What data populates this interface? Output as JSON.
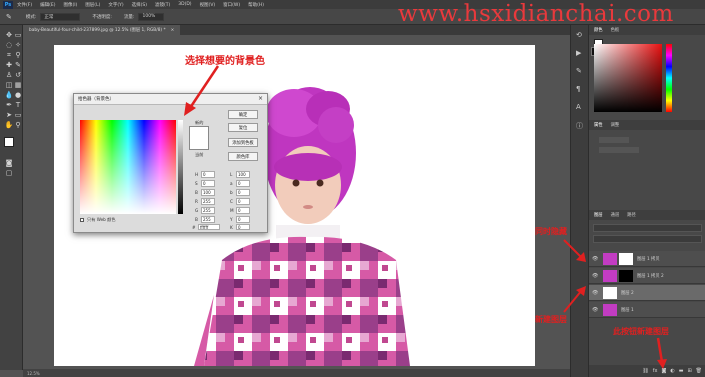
{
  "menubar": {
    "app_icon": "Ps",
    "items": [
      "文件(F)",
      "编辑(E)",
      "图像(I)",
      "图层(L)",
      "文字(Y)",
      "选择(S)",
      "滤镜(T)",
      "3D(D)",
      "视图(V)",
      "窗口(W)",
      "帮助(H)"
    ]
  },
  "options": {
    "mode_label": "模式:",
    "mode_value": "正常",
    "opacity_label": "不透明度:",
    "flow_label": "流量:",
    "flow_value": "100%"
  },
  "document": {
    "tab_title": "baby-Beautiful-four-child-237899.jpg @ 12.5% (图层 1, RGB/8) *",
    "status_zoom": "12.5%"
  },
  "picker": {
    "title": "拾色器（背景色）",
    "ok": "确定",
    "cancel": "复位",
    "add_to_swatches": "添加到色板",
    "color_libraries": "颜色库",
    "new_label": "新的",
    "current_label": "当前",
    "web_only": "只有 Web 颜色",
    "h_val": "0",
    "s_val": "0",
    "b_val": "100",
    "r_val": "255",
    "g_val": "255",
    "b2_val": "255",
    "l_val": "100",
    "a_val": "0",
    "bb_val": "0",
    "c_val": "0",
    "m_val": "0",
    "y_val": "0",
    "k_val": "0",
    "hex": "ffffff"
  },
  "panels": {
    "color_tab": "颜色",
    "swatches_tab": "色板",
    "properties_tab": "属性",
    "adjust_tab": "调整",
    "layers_tab": "图层",
    "channels_tab": "通道",
    "paths_tab": "路径",
    "layers": [
      {
        "name": "图层 1 拷贝"
      },
      {
        "name": "图层 1 拷贝 2"
      },
      {
        "name": "图层 2"
      },
      {
        "name": "图层 1"
      }
    ]
  },
  "annotations": {
    "choose_bg": "选择想要的背景色",
    "hide_both": "同时隐藏",
    "new_layer": "新建图层",
    "new_layer_btn": "此按钮新建图层",
    "watermark": "www.hsxidianchai.com"
  },
  "colors": {
    "annotation_red": "#e02020",
    "hair_magenta": "#c23cc2",
    "jacket_pink": "#d65aa6"
  }
}
